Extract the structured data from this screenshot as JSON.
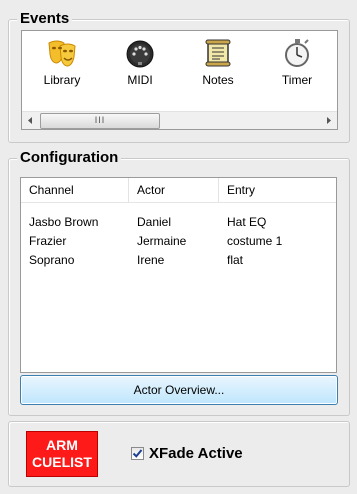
{
  "events": {
    "title": "Events",
    "items": [
      {
        "label": "Library",
        "icon": "theater-masks-icon"
      },
      {
        "label": "MIDI",
        "icon": "midi-connector-icon"
      },
      {
        "label": "Notes",
        "icon": "notes-icon"
      },
      {
        "label": "Timer",
        "icon": "stopwatch-icon"
      }
    ],
    "scroll_grip": "III"
  },
  "configuration": {
    "title": "Configuration",
    "columns": [
      "Channel",
      "Actor",
      "Entry"
    ],
    "rows": [
      [
        "Jasbo Brown",
        "Daniel",
        "Hat EQ"
      ],
      [
        "Frazier",
        "Jermaine",
        "costume 1"
      ],
      [
        "Soprano",
        "Irene",
        "flat"
      ]
    ],
    "overview_button": "Actor Overview..."
  },
  "footer": {
    "arm_line1": "ARM",
    "arm_line2": "CUELIST",
    "xfade_label": "XFade Active",
    "xfade_checked": true
  },
  "colors": {
    "arm_button": "#ff1a1a",
    "overview_button_border": "#3c7fb1",
    "library_icon": "#f2b928"
  }
}
